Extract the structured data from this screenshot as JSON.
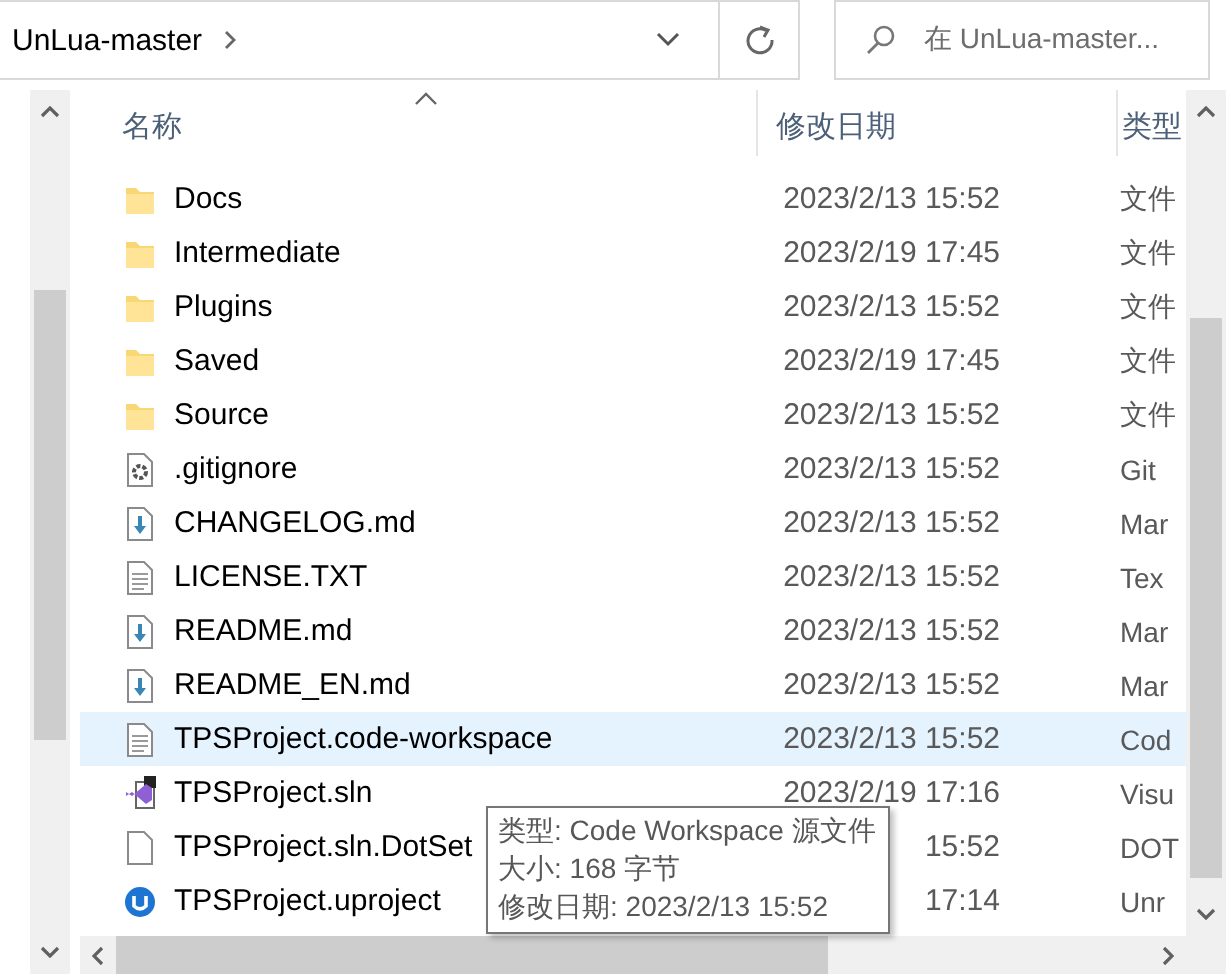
{
  "address_bar": {
    "path": "UnLua-master"
  },
  "search": {
    "placeholder": "在 UnLua-master..."
  },
  "columns": [
    {
      "label": "名称",
      "sorted": true
    },
    {
      "label": "修改日期",
      "sorted": false
    },
    {
      "label": "类型",
      "sorted": false
    }
  ],
  "rows": [
    {
      "name": "Docs",
      "date": "2023/2/13 15:52",
      "type": "文件",
      "kind": "folder",
      "selected": false
    },
    {
      "name": "Intermediate",
      "date": "2023/2/19 17:45",
      "type": "文件",
      "kind": "folder",
      "selected": false
    },
    {
      "name": "Plugins",
      "date": "2023/2/13 15:52",
      "type": "文件",
      "kind": "folder",
      "selected": false
    },
    {
      "name": "Saved",
      "date": "2023/2/19 17:45",
      "type": "文件",
      "kind": "folder",
      "selected": false
    },
    {
      "name": "Source",
      "date": "2023/2/13 15:52",
      "type": "文件",
      "kind": "folder",
      "selected": false
    },
    {
      "name": ".gitignore",
      "date": "2023/2/13 15:52",
      "type": "Git",
      "kind": "settings",
      "selected": false
    },
    {
      "name": "CHANGELOG.md",
      "date": "2023/2/13 15:52",
      "type": "Mar",
      "kind": "markdown",
      "selected": false
    },
    {
      "name": "LICENSE.TXT",
      "date": "2023/2/13 15:52",
      "type": "Tex",
      "kind": "text",
      "selected": false
    },
    {
      "name": "README.md",
      "date": "2023/2/13 15:52",
      "type": "Mar",
      "kind": "markdown",
      "selected": false
    },
    {
      "name": "README_EN.md",
      "date": "2023/2/13 15:52",
      "type": "Mar",
      "kind": "markdown",
      "selected": false
    },
    {
      "name": "TPSProject.code-workspace",
      "date": "2023/2/13 15:52",
      "type": "Cod",
      "kind": "text",
      "selected": true
    },
    {
      "name": "TPSProject.sln",
      "date": "2023/2/19 17:16",
      "type": "Visu",
      "kind": "solution",
      "selected": false
    },
    {
      "name": "TPSProject.sln.DotSet",
      "date": "15:52",
      "type": "DOT",
      "kind": "blank",
      "selected": false
    },
    {
      "name": "TPSProject.uproject",
      "date": "17:14",
      "type": "Unr",
      "kind": "unreal",
      "selected": false
    }
  ],
  "tooltip": {
    "lines": [
      "类型: Code Workspace 源文件",
      "大小: 168 字节",
      "修改日期: 2023/2/13 15:52"
    ]
  }
}
